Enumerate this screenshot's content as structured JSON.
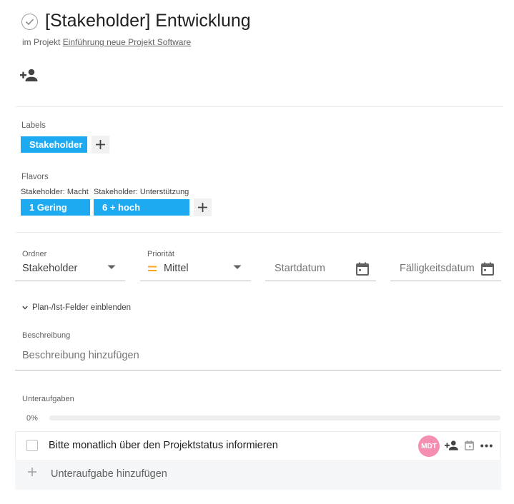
{
  "task": {
    "title": "[Stakeholder] Entwicklung",
    "project_prefix": "im Projekt",
    "project_name": "Einführung neue Projekt Software"
  },
  "labels": {
    "heading": "Labels",
    "items": [
      "Stakeholder"
    ]
  },
  "flavors": {
    "heading": "Flavors",
    "items": [
      {
        "name": "Stakeholder: Macht",
        "value": "1 Gering"
      },
      {
        "name": "Stakeholder: Unterstützung",
        "value": "6 + hoch"
      }
    ]
  },
  "fields": {
    "folder": {
      "label": "Ordner",
      "value": "Stakeholder"
    },
    "priority": {
      "label": "Priorität",
      "value": "Mittel",
      "color": "#f5a623"
    },
    "start_date": {
      "placeholder": "Startdatum"
    },
    "due_date": {
      "placeholder": "Fälligkeitsdatum"
    }
  },
  "plan_toggle": "Plan-/Ist-Felder einblenden",
  "description": {
    "label": "Beschreibung",
    "placeholder": "Beschreibung hinzufügen"
  },
  "subtasks": {
    "heading": "Unteraufgaben",
    "progress_text": "0%",
    "progress": 0,
    "items": [
      {
        "text": "Bitte monatlich über den Projektstatus informieren",
        "assignee_initials": "MDT"
      }
    ],
    "add_label": "Unteraufgabe hinzufügen"
  },
  "colors": {
    "accent": "#1eaaf1",
    "avatar": "#f48fb1"
  }
}
